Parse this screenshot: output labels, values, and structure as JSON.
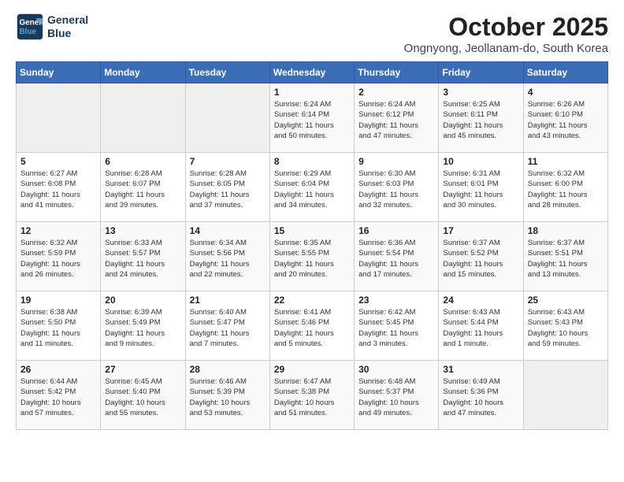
{
  "header": {
    "logo_line1": "General",
    "logo_line2": "Blue",
    "month_title": "October 2025",
    "subtitle": "Ongnyong, Jeollanam-do, South Korea"
  },
  "days_of_week": [
    "Sunday",
    "Monday",
    "Tuesday",
    "Wednesday",
    "Thursday",
    "Friday",
    "Saturday"
  ],
  "weeks": [
    [
      {
        "day": "",
        "content": ""
      },
      {
        "day": "",
        "content": ""
      },
      {
        "day": "",
        "content": ""
      },
      {
        "day": "1",
        "content": "Sunrise: 6:24 AM\nSunset: 6:14 PM\nDaylight: 11 hours\nand 50 minutes."
      },
      {
        "day": "2",
        "content": "Sunrise: 6:24 AM\nSunset: 6:12 PM\nDaylight: 11 hours\nand 47 minutes."
      },
      {
        "day": "3",
        "content": "Sunrise: 6:25 AM\nSunset: 6:11 PM\nDaylight: 11 hours\nand 45 minutes."
      },
      {
        "day": "4",
        "content": "Sunrise: 6:26 AM\nSunset: 6:10 PM\nDaylight: 11 hours\nand 43 minutes."
      }
    ],
    [
      {
        "day": "5",
        "content": "Sunrise: 6:27 AM\nSunset: 6:08 PM\nDaylight: 11 hours\nand 41 minutes."
      },
      {
        "day": "6",
        "content": "Sunrise: 6:28 AM\nSunset: 6:07 PM\nDaylight: 11 hours\nand 39 minutes."
      },
      {
        "day": "7",
        "content": "Sunrise: 6:28 AM\nSunset: 6:05 PM\nDaylight: 11 hours\nand 37 minutes."
      },
      {
        "day": "8",
        "content": "Sunrise: 6:29 AM\nSunset: 6:04 PM\nDaylight: 11 hours\nand 34 minutes."
      },
      {
        "day": "9",
        "content": "Sunrise: 6:30 AM\nSunset: 6:03 PM\nDaylight: 11 hours\nand 32 minutes."
      },
      {
        "day": "10",
        "content": "Sunrise: 6:31 AM\nSunset: 6:01 PM\nDaylight: 11 hours\nand 30 minutes."
      },
      {
        "day": "11",
        "content": "Sunrise: 6:32 AM\nSunset: 6:00 PM\nDaylight: 11 hours\nand 28 minutes."
      }
    ],
    [
      {
        "day": "12",
        "content": "Sunrise: 6:32 AM\nSunset: 5:59 PM\nDaylight: 11 hours\nand 26 minutes."
      },
      {
        "day": "13",
        "content": "Sunrise: 6:33 AM\nSunset: 5:57 PM\nDaylight: 11 hours\nand 24 minutes."
      },
      {
        "day": "14",
        "content": "Sunrise: 6:34 AM\nSunset: 5:56 PM\nDaylight: 11 hours\nand 22 minutes."
      },
      {
        "day": "15",
        "content": "Sunrise: 6:35 AM\nSunset: 5:55 PM\nDaylight: 11 hours\nand 20 minutes."
      },
      {
        "day": "16",
        "content": "Sunrise: 6:36 AM\nSunset: 5:54 PM\nDaylight: 11 hours\nand 17 minutes."
      },
      {
        "day": "17",
        "content": "Sunrise: 6:37 AM\nSunset: 5:52 PM\nDaylight: 11 hours\nand 15 minutes."
      },
      {
        "day": "18",
        "content": "Sunrise: 6:37 AM\nSunset: 5:51 PM\nDaylight: 11 hours\nand 13 minutes."
      }
    ],
    [
      {
        "day": "19",
        "content": "Sunrise: 6:38 AM\nSunset: 5:50 PM\nDaylight: 11 hours\nand 11 minutes."
      },
      {
        "day": "20",
        "content": "Sunrise: 6:39 AM\nSunset: 5:49 PM\nDaylight: 11 hours\nand 9 minutes."
      },
      {
        "day": "21",
        "content": "Sunrise: 6:40 AM\nSunset: 5:47 PM\nDaylight: 11 hours\nand 7 minutes."
      },
      {
        "day": "22",
        "content": "Sunrise: 6:41 AM\nSunset: 5:46 PM\nDaylight: 11 hours\nand 5 minutes."
      },
      {
        "day": "23",
        "content": "Sunrise: 6:42 AM\nSunset: 5:45 PM\nDaylight: 11 hours\nand 3 minutes."
      },
      {
        "day": "24",
        "content": "Sunrise: 6:43 AM\nSunset: 5:44 PM\nDaylight: 11 hours\nand 1 minute."
      },
      {
        "day": "25",
        "content": "Sunrise: 6:43 AM\nSunset: 5:43 PM\nDaylight: 10 hours\nand 59 minutes."
      }
    ],
    [
      {
        "day": "26",
        "content": "Sunrise: 6:44 AM\nSunset: 5:42 PM\nDaylight: 10 hours\nand 57 minutes."
      },
      {
        "day": "27",
        "content": "Sunrise: 6:45 AM\nSunset: 5:40 PM\nDaylight: 10 hours\nand 55 minutes."
      },
      {
        "day": "28",
        "content": "Sunrise: 6:46 AM\nSunset: 5:39 PM\nDaylight: 10 hours\nand 53 minutes."
      },
      {
        "day": "29",
        "content": "Sunrise: 6:47 AM\nSunset: 5:38 PM\nDaylight: 10 hours\nand 51 minutes."
      },
      {
        "day": "30",
        "content": "Sunrise: 6:48 AM\nSunset: 5:37 PM\nDaylight: 10 hours\nand 49 minutes."
      },
      {
        "day": "31",
        "content": "Sunrise: 6:49 AM\nSunset: 5:36 PM\nDaylight: 10 hours\nand 47 minutes."
      },
      {
        "day": "",
        "content": ""
      }
    ]
  ]
}
